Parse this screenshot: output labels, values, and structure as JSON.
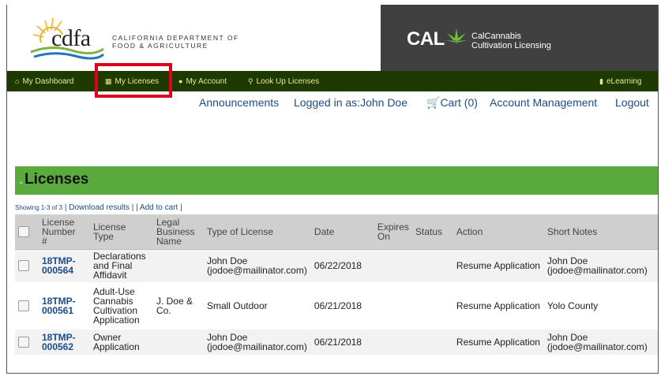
{
  "header": {
    "cdfa_logo_text": "cdfa",
    "cdfa_dept_line1": "CALIFORNIA DEPARTMENT OF",
    "cdfa_dept_line2": "FOOD & AGRICULTURE",
    "cal_logo_text": "CAL",
    "cal_sub_line1": "CalCannabis",
    "cal_sub_line2": "Cultivation Licensing"
  },
  "nav": {
    "dashboard": "My Dashboard",
    "my_licenses": "My Licenses",
    "my_account": "My Account",
    "lookup": "Look Up Licenses",
    "elearning": "eLearning"
  },
  "toplinks": {
    "announcements": "Announcements",
    "logged_in": "Logged in as:John Doe",
    "cart": "Cart (0)",
    "account_management": "Account Management",
    "logout": "Logout"
  },
  "licenses": {
    "title": "Licenses",
    "showing": "Showing 1-3 of 3",
    "download": "Download results",
    "add_to_cart": "Add to cart"
  },
  "table": {
    "headers": {
      "license_number": [
        "License",
        "Number",
        "#"
      ],
      "license_type": [
        "License",
        "Type"
      ],
      "legal_business_name": [
        "Legal",
        "Business",
        "Name"
      ],
      "type_of_license": "Type of License",
      "date": "Date",
      "expires_on": [
        "Expires",
        "On"
      ],
      "status": "Status",
      "action": "Action",
      "short_notes": "Short Notes"
    },
    "rows": [
      {
        "license_number": [
          "18TMP-",
          "000564"
        ],
        "license_type": [
          "Declarations",
          "and Final",
          "Affidavit"
        ],
        "legal_business_name": [
          "",
          ""
        ],
        "type_of_license": [
          "John Doe",
          "(jodoe@mailinator.com)"
        ],
        "date": "06/22/2018",
        "expires_on": "",
        "status": "",
        "action": "Resume Application",
        "short_notes": [
          "John Doe",
          "(jodoe@mailinator.com)"
        ]
      },
      {
        "license_number": [
          "18TMP-",
          "000561"
        ],
        "license_type": [
          "Adult-Use",
          "Cannabis",
          "Cultivation",
          "Application"
        ],
        "legal_business_name": [
          "J. Doe &",
          "Co."
        ],
        "type_of_license": [
          "Small Outdoor",
          ""
        ],
        "date": "06/21/2018",
        "expires_on": "",
        "status": "",
        "action": "Resume Application",
        "short_notes": [
          "Yolo County",
          ""
        ]
      },
      {
        "license_number": [
          "18TMP-",
          "000562"
        ],
        "license_type": [
          "Owner",
          "Application"
        ],
        "legal_business_name": [
          "",
          ""
        ],
        "type_of_license": [
          "John Doe",
          "(jodoe@mailinator.com)"
        ],
        "date": "06/21/2018",
        "expires_on": "",
        "status": "",
        "action": "Resume Application",
        "short_notes": [
          "John Doe",
          "(jodoe@mailinator.com)"
        ]
      }
    ]
  },
  "colors": {
    "nav_bg": "#1f3a00",
    "nav_text": "#e9e98a",
    "link": "#1a4c8a",
    "section_green": "#5aaa3d",
    "highlight_red": "#e0001b",
    "header_dark": "#404040"
  },
  "icons": {
    "dashboard": "home-icon",
    "my_licenses": "id-card-icon",
    "my_account": "user-icon",
    "lookup": "search-icon",
    "elearning": "book-icon",
    "cart": "cart-icon"
  }
}
